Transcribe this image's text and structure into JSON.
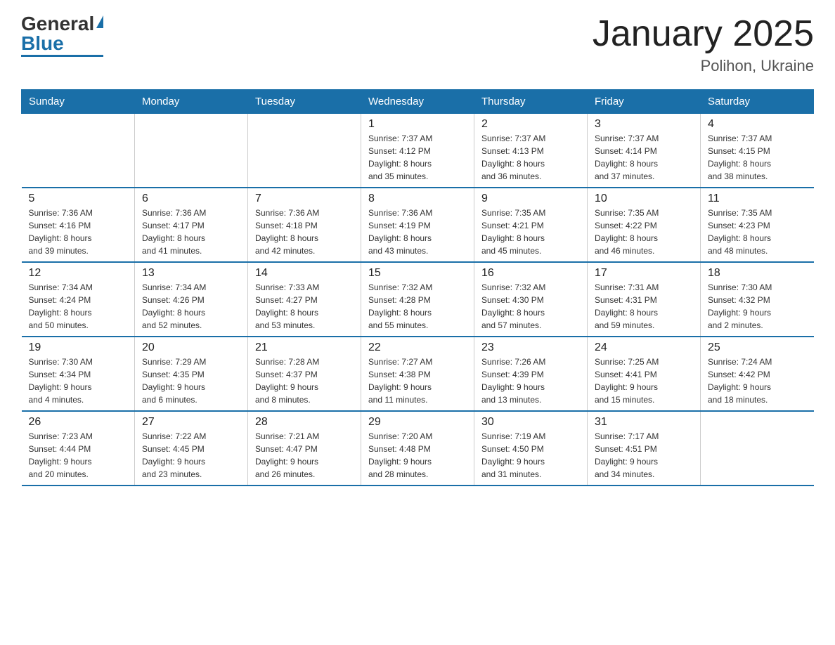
{
  "logo": {
    "general": "General",
    "blue": "Blue"
  },
  "title": "January 2025",
  "subtitle": "Polihon, Ukraine",
  "days_header": [
    "Sunday",
    "Monday",
    "Tuesday",
    "Wednesday",
    "Thursday",
    "Friday",
    "Saturday"
  ],
  "weeks": [
    [
      {
        "day": "",
        "info": ""
      },
      {
        "day": "",
        "info": ""
      },
      {
        "day": "",
        "info": ""
      },
      {
        "day": "1",
        "info": "Sunrise: 7:37 AM\nSunset: 4:12 PM\nDaylight: 8 hours\nand 35 minutes."
      },
      {
        "day": "2",
        "info": "Sunrise: 7:37 AM\nSunset: 4:13 PM\nDaylight: 8 hours\nand 36 minutes."
      },
      {
        "day": "3",
        "info": "Sunrise: 7:37 AM\nSunset: 4:14 PM\nDaylight: 8 hours\nand 37 minutes."
      },
      {
        "day": "4",
        "info": "Sunrise: 7:37 AM\nSunset: 4:15 PM\nDaylight: 8 hours\nand 38 minutes."
      }
    ],
    [
      {
        "day": "5",
        "info": "Sunrise: 7:36 AM\nSunset: 4:16 PM\nDaylight: 8 hours\nand 39 minutes."
      },
      {
        "day": "6",
        "info": "Sunrise: 7:36 AM\nSunset: 4:17 PM\nDaylight: 8 hours\nand 41 minutes."
      },
      {
        "day": "7",
        "info": "Sunrise: 7:36 AM\nSunset: 4:18 PM\nDaylight: 8 hours\nand 42 minutes."
      },
      {
        "day": "8",
        "info": "Sunrise: 7:36 AM\nSunset: 4:19 PM\nDaylight: 8 hours\nand 43 minutes."
      },
      {
        "day": "9",
        "info": "Sunrise: 7:35 AM\nSunset: 4:21 PM\nDaylight: 8 hours\nand 45 minutes."
      },
      {
        "day": "10",
        "info": "Sunrise: 7:35 AM\nSunset: 4:22 PM\nDaylight: 8 hours\nand 46 minutes."
      },
      {
        "day": "11",
        "info": "Sunrise: 7:35 AM\nSunset: 4:23 PM\nDaylight: 8 hours\nand 48 minutes."
      }
    ],
    [
      {
        "day": "12",
        "info": "Sunrise: 7:34 AM\nSunset: 4:24 PM\nDaylight: 8 hours\nand 50 minutes."
      },
      {
        "day": "13",
        "info": "Sunrise: 7:34 AM\nSunset: 4:26 PM\nDaylight: 8 hours\nand 52 minutes."
      },
      {
        "day": "14",
        "info": "Sunrise: 7:33 AM\nSunset: 4:27 PM\nDaylight: 8 hours\nand 53 minutes."
      },
      {
        "day": "15",
        "info": "Sunrise: 7:32 AM\nSunset: 4:28 PM\nDaylight: 8 hours\nand 55 minutes."
      },
      {
        "day": "16",
        "info": "Sunrise: 7:32 AM\nSunset: 4:30 PM\nDaylight: 8 hours\nand 57 minutes."
      },
      {
        "day": "17",
        "info": "Sunrise: 7:31 AM\nSunset: 4:31 PM\nDaylight: 8 hours\nand 59 minutes."
      },
      {
        "day": "18",
        "info": "Sunrise: 7:30 AM\nSunset: 4:32 PM\nDaylight: 9 hours\nand 2 minutes."
      }
    ],
    [
      {
        "day": "19",
        "info": "Sunrise: 7:30 AM\nSunset: 4:34 PM\nDaylight: 9 hours\nand 4 minutes."
      },
      {
        "day": "20",
        "info": "Sunrise: 7:29 AM\nSunset: 4:35 PM\nDaylight: 9 hours\nand 6 minutes."
      },
      {
        "day": "21",
        "info": "Sunrise: 7:28 AM\nSunset: 4:37 PM\nDaylight: 9 hours\nand 8 minutes."
      },
      {
        "day": "22",
        "info": "Sunrise: 7:27 AM\nSunset: 4:38 PM\nDaylight: 9 hours\nand 11 minutes."
      },
      {
        "day": "23",
        "info": "Sunrise: 7:26 AM\nSunset: 4:39 PM\nDaylight: 9 hours\nand 13 minutes."
      },
      {
        "day": "24",
        "info": "Sunrise: 7:25 AM\nSunset: 4:41 PM\nDaylight: 9 hours\nand 15 minutes."
      },
      {
        "day": "25",
        "info": "Sunrise: 7:24 AM\nSunset: 4:42 PM\nDaylight: 9 hours\nand 18 minutes."
      }
    ],
    [
      {
        "day": "26",
        "info": "Sunrise: 7:23 AM\nSunset: 4:44 PM\nDaylight: 9 hours\nand 20 minutes."
      },
      {
        "day": "27",
        "info": "Sunrise: 7:22 AM\nSunset: 4:45 PM\nDaylight: 9 hours\nand 23 minutes."
      },
      {
        "day": "28",
        "info": "Sunrise: 7:21 AM\nSunset: 4:47 PM\nDaylight: 9 hours\nand 26 minutes."
      },
      {
        "day": "29",
        "info": "Sunrise: 7:20 AM\nSunset: 4:48 PM\nDaylight: 9 hours\nand 28 minutes."
      },
      {
        "day": "30",
        "info": "Sunrise: 7:19 AM\nSunset: 4:50 PM\nDaylight: 9 hours\nand 31 minutes."
      },
      {
        "day": "31",
        "info": "Sunrise: 7:17 AM\nSunset: 4:51 PM\nDaylight: 9 hours\nand 34 minutes."
      },
      {
        "day": "",
        "info": ""
      }
    ]
  ]
}
